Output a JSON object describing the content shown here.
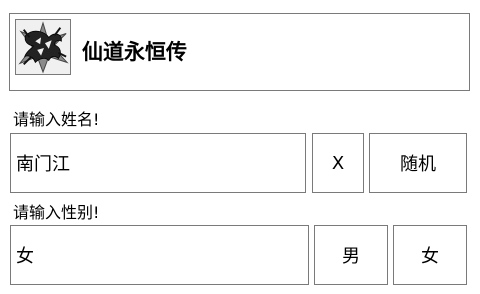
{
  "header": {
    "title": "仙道永恒传",
    "logo_icon": "dragon-emblem-icon"
  },
  "name_section": {
    "prompt": "请输入姓名!",
    "value": "南门江",
    "clear_label": "X",
    "random_label": "随机"
  },
  "gender_section": {
    "prompt": "请输入性别!",
    "value": "女",
    "male_label": "男",
    "female_label": "女"
  }
}
